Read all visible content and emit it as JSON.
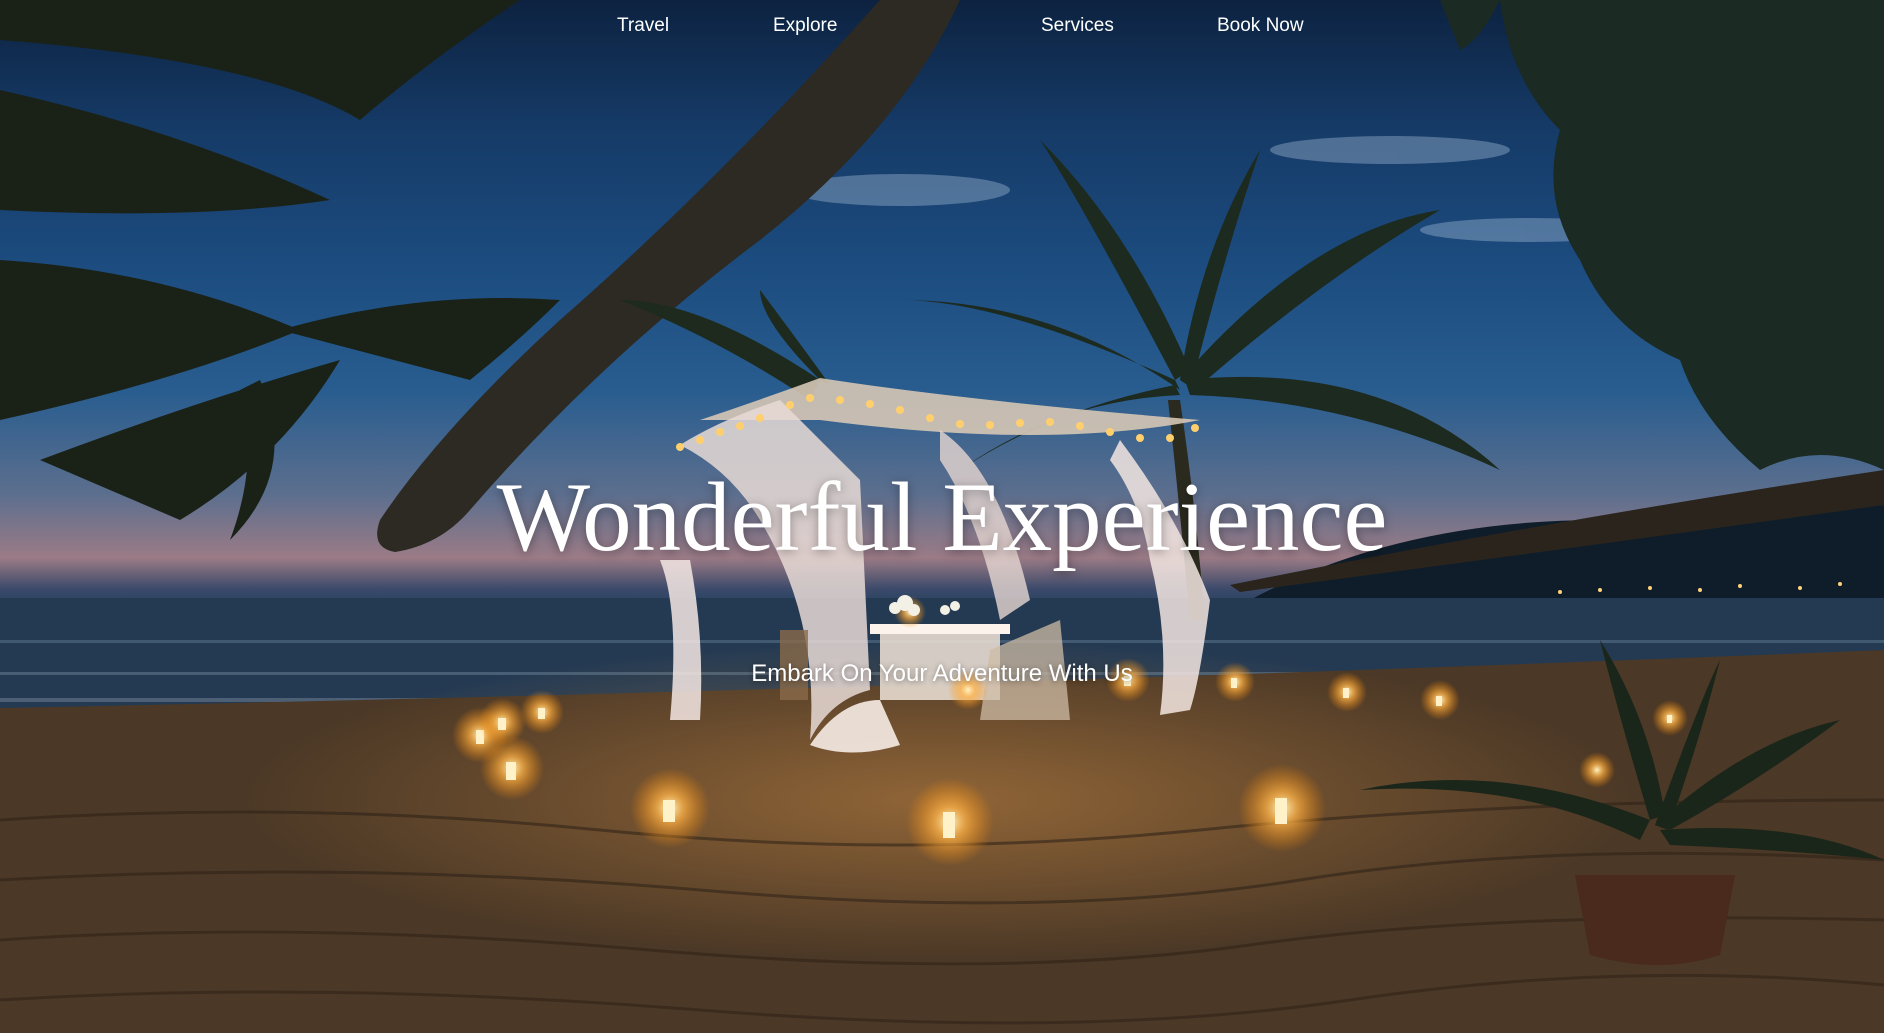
{
  "nav": {
    "links": [
      {
        "label": "Travel"
      },
      {
        "label": "Explore"
      },
      {
        "label": "Services"
      },
      {
        "label": "Book Now"
      }
    ]
  },
  "hero": {
    "headline": "Wonderful Experience",
    "tagline": "Embark On Your Adventure With Us",
    "background_description_icon": "beach-dinner-photo"
  },
  "colors": {
    "text": "#ffffff",
    "sky_top": "#0d2240",
    "sunset": "#9b7b86",
    "sand": "#4e3a26",
    "candle_glow": "#ffb347"
  }
}
